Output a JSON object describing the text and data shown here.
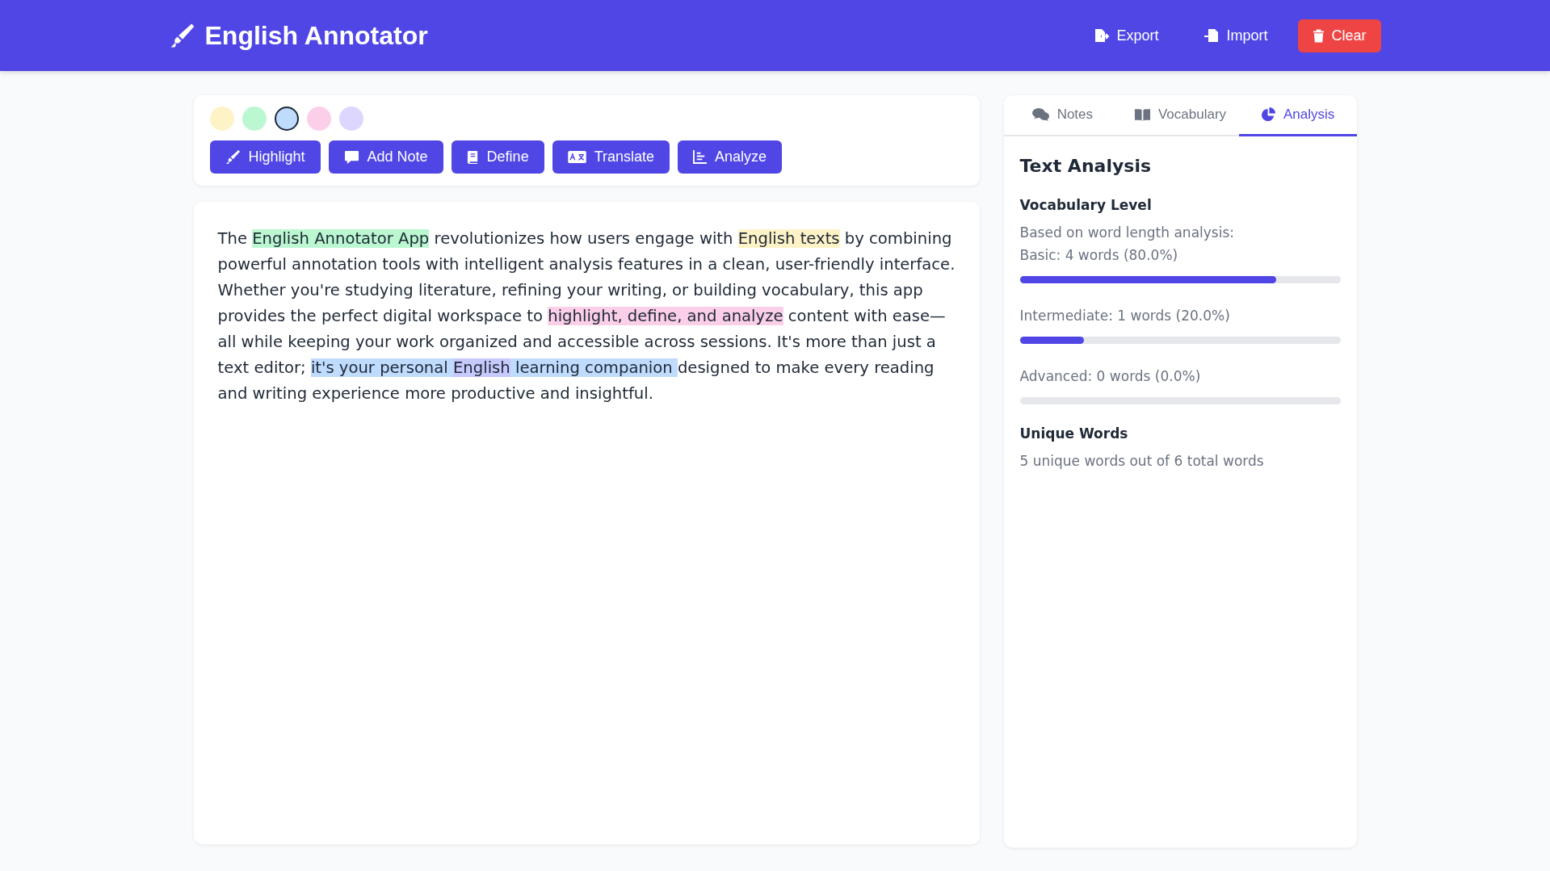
{
  "header": {
    "title": "English Annotator",
    "actions": [
      {
        "kind": "export",
        "label": "Export"
      },
      {
        "kind": "import",
        "label": "Import"
      },
      {
        "kind": "clear",
        "label": "Clear"
      }
    ]
  },
  "palette": [
    {
      "color": "#fef3c7",
      "selected": false
    },
    {
      "color": "#bbf7d0",
      "selected": false
    },
    {
      "color": "#bfdbfe",
      "selected": true
    },
    {
      "color": "#fbcfe8",
      "selected": false
    },
    {
      "color": "#ddd6fe",
      "selected": false
    }
  ],
  "tools": [
    {
      "kind": "highlight",
      "label": "Highlight"
    },
    {
      "kind": "note",
      "label": "Add Note"
    },
    {
      "kind": "define",
      "label": "Define"
    },
    {
      "kind": "translate",
      "label": "Translate"
    },
    {
      "kind": "analyze",
      "label": "Analyze"
    }
  ],
  "document": {
    "segments": [
      {
        "text": "The "
      },
      {
        "text": "English Annotator App",
        "color": "#bbf7d0"
      },
      {
        "text": " revolutionizes how users engage with "
      },
      {
        "text": "English texts",
        "color": "#fef3c7"
      },
      {
        "text": " by combining powerful annotation tools with intelligent analysis features in a clean, user-friendly interface. Whether you're studying literature, refining your writing, or building vocabulary, this app provides the perfect digital workspace to "
      },
      {
        "text": "highlight, define, and analyze",
        "color": "#fbcfe8"
      },
      {
        "text": " content with ease—all while keeping your work organized and accessible across sessions. It's more than just a text editor; "
      },
      {
        "text": "it's your personal ",
        "color": "#bfdbfe"
      },
      {
        "text": "English",
        "color": "#c7c8fc"
      },
      {
        "text": " learning companion ",
        "color": "#bfdbfe"
      },
      {
        "text": "designed to make every reading and writing experience more productive and insightful."
      }
    ]
  },
  "sidebar": {
    "tabs": [
      {
        "kind": "notes",
        "label": "Notes",
        "selected": false
      },
      {
        "kind": "vocabulary",
        "label": "Vocabulary",
        "selected": false
      },
      {
        "kind": "analysis",
        "label": "Analysis",
        "selected": true
      }
    ],
    "title": "Text Analysis",
    "vocabulary": {
      "heading": "Vocabulary Level",
      "intro": "Based on word length analysis:",
      "levels": [
        {
          "label": "Basic: 4 words (80.0%)",
          "level": 0.8
        },
        {
          "label": "Intermediate: 1 words (20.0%)",
          "level": 0.2
        },
        {
          "label": "Advanced: 0 words (0.0%)",
          "level": 0
        }
      ]
    },
    "unique": {
      "heading": "Unique Words",
      "text": "5 unique words out of 6 total words"
    }
  }
}
